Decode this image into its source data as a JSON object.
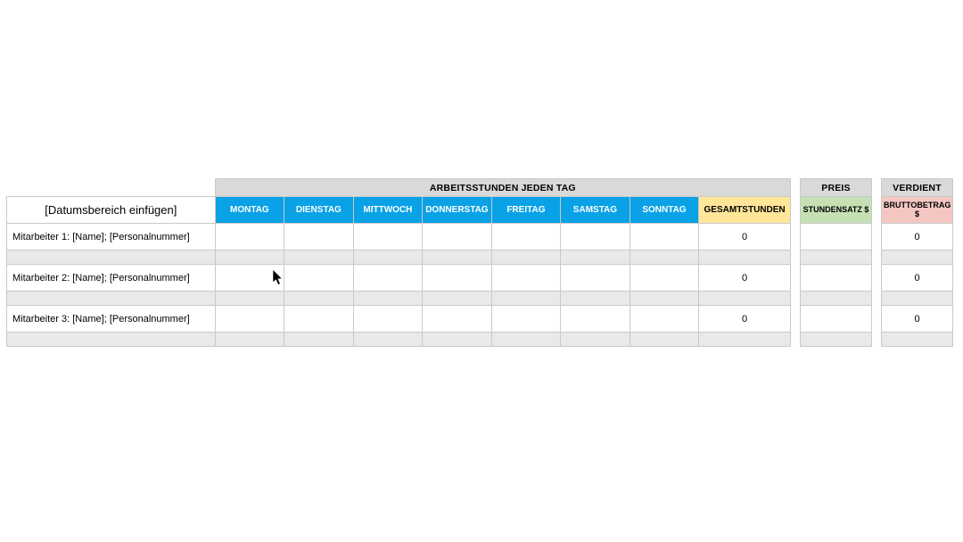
{
  "headers": {
    "date_range": "[Datumsbereich einfügen]",
    "hours_group": "ARBEITSSTUNDEN JEDEN TAG",
    "days": [
      "MONTAG",
      "DIENSTAG",
      "MITTWOCH",
      "DONNERSTAG",
      "FREITAG",
      "SAMSTAG",
      "SONNTAG"
    ],
    "total_hours": "GESAMTSTUNDEN",
    "price_group": "PREIS",
    "rate_label": "STUNDENSATZ $",
    "earned_group": "VERDIENT",
    "gross_label": "BRUTTOBETRAG $"
  },
  "rows": [
    {
      "label": "Mitarbeiter 1: [Name]; [Personalnummer]",
      "hours": [
        "",
        "",
        "",
        "",
        "",
        "",
        ""
      ],
      "total": "0",
      "rate": "",
      "gross": "0"
    },
    {
      "label": "Mitarbeiter 2: [Name]; [Personalnummer]",
      "hours": [
        "",
        "",
        "",
        "",
        "",
        "",
        ""
      ],
      "total": "0",
      "rate": "",
      "gross": "0"
    },
    {
      "label": "Mitarbeiter 3: [Name]; [Personalnummer]",
      "hours": [
        "",
        "",
        "",
        "",
        "",
        "",
        ""
      ],
      "total": "0",
      "rate": "",
      "gross": "0"
    }
  ]
}
